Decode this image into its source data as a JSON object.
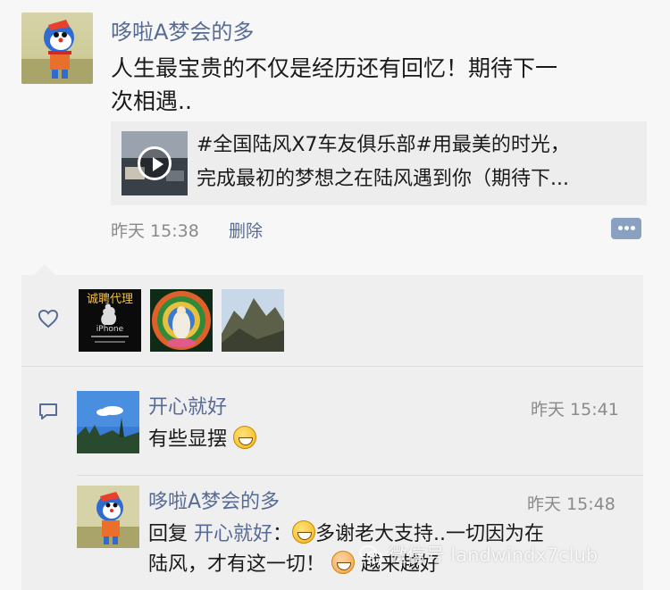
{
  "post": {
    "author": "哆啦A梦会的多",
    "text_line1": "人生最宝贵的不仅是经历还有回忆！期待下一",
    "text_line2": "次相遇..",
    "link": {
      "line1": "#全国陆风X7车友俱乐部#用最美的时光，",
      "line2": "完成最初的梦想之在陆风遇到你（期待下..."
    },
    "time": "昨天 15:38",
    "delete_label": "删除"
  },
  "likes": {
    "icon": "heart-outline-icon",
    "avatar1_line1": "诚聘代理",
    "avatar1_small": "iPhone"
  },
  "comments": {
    "icon": "comment-icon",
    "items": [
      {
        "name": "开心就好",
        "time": "昨天 15:41",
        "text": "有些显摆"
      },
      {
        "name": "哆啦A梦会的多",
        "time": "昨天 15:48",
        "reply_prefix": "回复",
        "reply_target": "开心就好",
        "colon": "：",
        "text_line1": "多谢老大支持..一切因为在",
        "text_line2": "陆风，才有这一切！",
        "text_line3": "越来越好"
      }
    ]
  },
  "watermark": "微信号 landwindx7club",
  "colors": {
    "link_blue": "#576b95",
    "panel_bg": "#efeff0",
    "page_bg": "#f7f7f7"
  }
}
